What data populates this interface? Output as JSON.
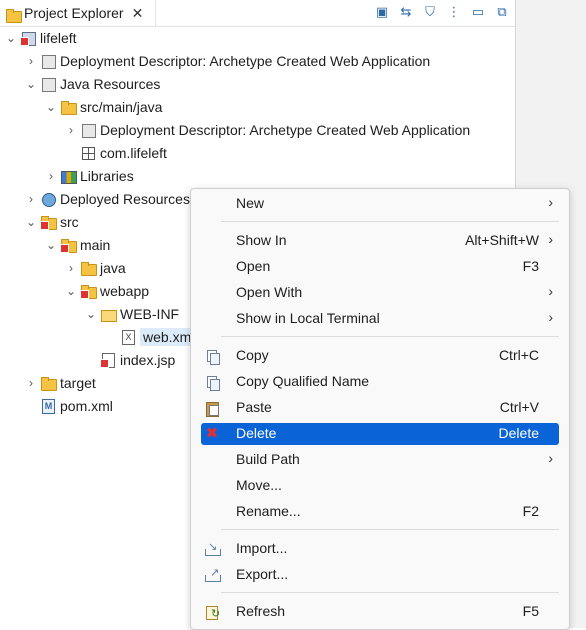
{
  "tab": {
    "title": "Project Explorer",
    "close": "✕",
    "toolbar": [
      "▣",
      "⇆",
      "⛉",
      "⋮",
      "▭",
      "⧉"
    ]
  },
  "tree": [
    {
      "label": "lifeleft",
      "arrow": "⌄",
      "icon": "project",
      "depth": 0
    },
    {
      "label": "Deployment Descriptor: Archetype Created Web Application",
      "arrow": "›",
      "icon": "descriptor",
      "depth": 1
    },
    {
      "label": "Java Resources",
      "arrow": "⌄",
      "icon": "java-resources",
      "depth": 1
    },
    {
      "label": "src/main/java",
      "arrow": "⌄",
      "icon": "source-folder",
      "depth": 2
    },
    {
      "label": "Deployment Descriptor: Archetype Created Web Application",
      "arrow": "›",
      "icon": "descriptor",
      "depth": 3
    },
    {
      "label": "com.lifeleft",
      "arrow": "",
      "icon": "package",
      "depth": 3
    },
    {
      "label": "Libraries",
      "arrow": "›",
      "icon": "libraries",
      "depth": 2
    },
    {
      "label": "Deployed Resources",
      "arrow": "›",
      "icon": "deployed",
      "depth": 1
    },
    {
      "label": "src",
      "arrow": "⌄",
      "icon": "folder-error",
      "depth": 1
    },
    {
      "label": "main",
      "arrow": "⌄",
      "icon": "folder-error",
      "depth": 2
    },
    {
      "label": "java",
      "arrow": "›",
      "icon": "folder",
      "depth": 3
    },
    {
      "label": "webapp",
      "arrow": "⌄",
      "icon": "folder-error",
      "depth": 3
    },
    {
      "label": "WEB-INF",
      "arrow": "⌄",
      "icon": "folder-open",
      "depth": 4
    },
    {
      "label": "web.xml",
      "arrow": "",
      "icon": "xml-file",
      "depth": 5,
      "selected": true
    },
    {
      "label": "index.jsp",
      "arrow": "",
      "icon": "jsp-file",
      "depth": 4
    },
    {
      "label": "target",
      "arrow": "›",
      "icon": "folder",
      "depth": 1
    },
    {
      "label": "pom.xml",
      "arrow": "",
      "icon": "pom-file",
      "depth": 1
    }
  ],
  "menu": {
    "new": {
      "label": "New",
      "shortcut": "",
      "sub": "›"
    },
    "show_in": {
      "label": "Show In",
      "shortcut": "Alt+Shift+W",
      "sub": "›"
    },
    "open": {
      "label": "Open",
      "shortcut": "F3"
    },
    "open_with": {
      "label": "Open With",
      "sub": "›"
    },
    "show_terminal": {
      "label": "Show in Local Terminal",
      "sub": "›"
    },
    "copy": {
      "label": "Copy",
      "shortcut": "Ctrl+C"
    },
    "copy_qualified": {
      "label": "Copy Qualified Name"
    },
    "paste": {
      "label": "Paste",
      "shortcut": "Ctrl+V"
    },
    "delete": {
      "label": "Delete",
      "shortcut": "Delete",
      "icon": "✖"
    },
    "build_path": {
      "label": "Build Path",
      "sub": "›"
    },
    "move": {
      "label": "Move..."
    },
    "rename": {
      "label": "Rename...",
      "shortcut": "F2"
    },
    "import": {
      "label": "Import..."
    },
    "export": {
      "label": "Export..."
    },
    "refresh": {
      "label": "Refresh",
      "shortcut": "F5"
    }
  },
  "colors": {
    "highlight": "#0a64d8",
    "selection": "#dcebfa"
  }
}
